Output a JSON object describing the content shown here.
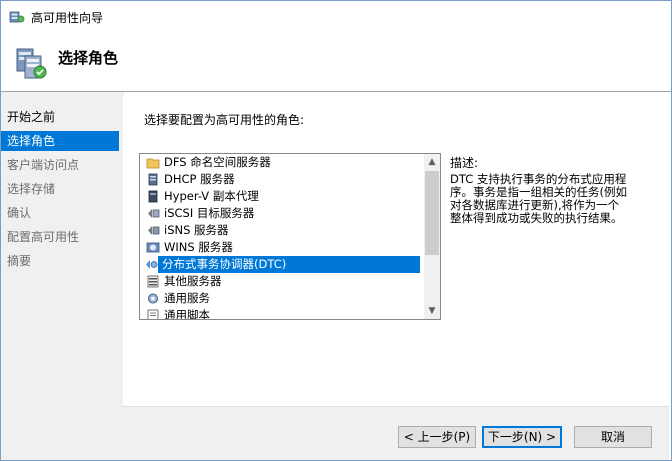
{
  "window": {
    "title": "高可用性向导"
  },
  "header": {
    "page_title": "选择角色"
  },
  "sidebar": {
    "items": [
      {
        "label": "开始之前",
        "state": "done"
      },
      {
        "label": "选择角色",
        "state": "active"
      },
      {
        "label": "客户端访问点",
        "state": "pending"
      },
      {
        "label": "选择存储",
        "state": "pending"
      },
      {
        "label": "确认",
        "state": "pending"
      },
      {
        "label": "配置高可用性",
        "state": "pending"
      },
      {
        "label": "摘要",
        "state": "pending"
      }
    ]
  },
  "main": {
    "prompt": "选择要配置为高可用性的角色:",
    "roles": [
      {
        "label": "DFS 命名空间服务器",
        "icon": "dfs-folder-icon"
      },
      {
        "label": "DHCP 服务器",
        "icon": "dhcp-server-icon"
      },
      {
        "label": "Hyper-V 副本代理",
        "icon": "hyperv-icon"
      },
      {
        "label": "iSCSI 目标服务器",
        "icon": "iscsi-icon"
      },
      {
        "label": "iSNS 服务器",
        "icon": "isns-icon"
      },
      {
        "label": "WINS 服务器",
        "icon": "wins-icon"
      },
      {
        "label": "分布式事务协调器(DTC)",
        "icon": "dtc-icon",
        "selected": true
      },
      {
        "label": "其他服务器",
        "icon": "other-server-icon"
      },
      {
        "label": "通用服务",
        "icon": "generic-service-icon"
      },
      {
        "label": "通用脚本",
        "icon": "generic-script-icon"
      }
    ],
    "description_label": "描述:",
    "description_lines": [
      "DTC 支持执行事务的分布式应用程",
      "序。事务是指一组相关的任务(例如",
      "对各数据库进行更新),将作为一个",
      "整体得到成功或失败的执行结果。"
    ]
  },
  "buttons": {
    "prev": "< 上一步(P)",
    "next": "下一步(N) >",
    "cancel": "取消"
  },
  "colors": {
    "accent": "#0078d7",
    "sidebar_bg": "#f0f0f0"
  }
}
